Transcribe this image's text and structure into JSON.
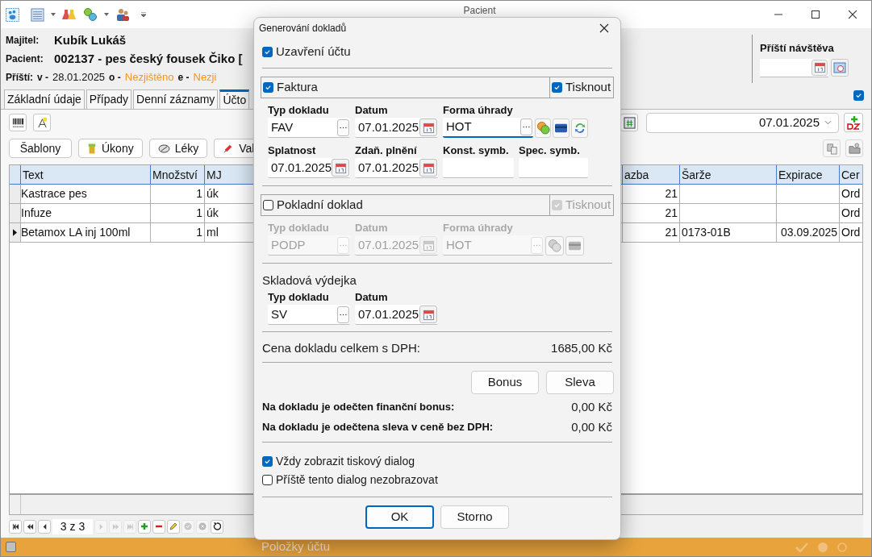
{
  "window": {
    "title": "Pacient"
  },
  "header": {
    "owner_label": "Majitel:",
    "owner": "Kubík Lukáš",
    "patient_label": "Pacient:",
    "patient": "002137 - pes český fousek Čiko [",
    "next_label": "Příští:",
    "next_items": [
      {
        "label": "v -",
        "value": "28.01.2025",
        "kind": "date"
      },
      {
        "label": "o -",
        "value": "Nezjištěno",
        "kind": "unknown"
      },
      {
        "label": "e -",
        "value": "Nezji",
        "kind": "unknown"
      }
    ]
  },
  "next_visit": {
    "title": "Příští návštěva"
  },
  "tabs": [
    {
      "label": "Základní údaje",
      "selected": false
    },
    {
      "label": "Případy",
      "selected": false
    },
    {
      "label": "Denní záznamy",
      "selected": false
    },
    {
      "label": "Účto",
      "selected": true
    }
  ],
  "flag": {
    "checked": true
  },
  "action_buttons": [
    {
      "label": "Šablony",
      "kind": "plain"
    },
    {
      "label": "Úkony",
      "kind": "procedure"
    },
    {
      "label": "Léky",
      "kind": "drug"
    },
    {
      "label": "Val",
      "kind": "syringe"
    }
  ],
  "date_select": {
    "value": "07.01.2025"
  },
  "table": {
    "columns": [
      "Text",
      "Množství",
      "MJ",
      "azba",
      "Šarže",
      "Expirace",
      "Cer"
    ],
    "rows": [
      {
        "cells": [
          "Kastrace pes",
          "1",
          "úk",
          "21",
          null,
          null,
          "Ord"
        ],
        "selected": false
      },
      {
        "cells": [
          "Infuze",
          "1",
          "úk",
          "21",
          null,
          null,
          "Ord"
        ],
        "selected": false
      },
      {
        "cells": [
          "Betamox LA inj 100ml",
          "1",
          "ml",
          "21",
          "0173-01B",
          "03.09.2025",
          "Ord"
        ],
        "selected": true
      }
    ]
  },
  "pager": {
    "text": "3 z 3"
  },
  "status_bar": {
    "text": "Položky účtu"
  },
  "dialog": {
    "title": "Generování dokladů",
    "close_account": {
      "label": "Uzavření účtu",
      "checked": true
    },
    "sections": [
      {
        "kind": "invoice",
        "label": "Faktura",
        "checked": true,
        "disabled": false,
        "print": {
          "label": "Tisknout",
          "checked": true,
          "disabled": false
        },
        "fields": [
          {
            "label": "Typ dokladu",
            "value": "FAV",
            "kind": "picker"
          },
          {
            "label": "Datum",
            "value": "07.01.2025",
            "kind": "date"
          },
          {
            "label": "Forma úhrady",
            "value": "HOT",
            "kind": "payment",
            "focused": true
          },
          {
            "label": "Splatnost",
            "value": "07.01.2025",
            "kind": "date"
          },
          {
            "label": "Zdaň. plnění",
            "value": "07.01.2025",
            "kind": "date"
          },
          {
            "label": "Konst. symb.",
            "kind": "text"
          },
          {
            "label": "Spec. symb.",
            "kind": "text"
          }
        ]
      },
      {
        "kind": "cash",
        "label": "Pokladní doklad",
        "checked": false,
        "disabled": true,
        "print": {
          "label": "Tisknout",
          "checked": true,
          "disabled": true
        },
        "fields": [
          {
            "label": "Typ dokladu",
            "value": "PODP",
            "kind": "picker"
          },
          {
            "label": "Datum",
            "value": "07.01.2025",
            "kind": "date"
          },
          {
            "label": "Forma úhrady",
            "value": "HOT",
            "kind": "payment",
            "focused": false
          }
        ]
      }
    ],
    "stock": {
      "label": "Skladová výdejka",
      "fields": [
        {
          "label": "Typ dokladu",
          "value": "SV",
          "kind": "picker"
        },
        {
          "label": "Datum",
          "value": "07.01.2025",
          "kind": "date"
        }
      ]
    },
    "total": {
      "label": "Cena dokladu celkem s DPH:",
      "value": "1685,00 Kč"
    },
    "adjust_buttons": [
      "Bonus",
      "Sleva"
    ],
    "deductions": [
      {
        "label": "Na dokladu je odečten finanční bonus:",
        "value": "0,00 Kč"
      },
      {
        "label": "Na dokladu je odečtena sleva v ceně bez DPH:",
        "value": "0,00 Kč"
      }
    ],
    "options": [
      {
        "label": "Vždy zobrazit tiskový dialog",
        "checked": true
      },
      {
        "label": "Příště tento dialog nezobrazovat",
        "checked": false
      }
    ],
    "buttons": [
      {
        "label": "OK",
        "default": true
      },
      {
        "label": "Storno",
        "default": false
      }
    ]
  }
}
